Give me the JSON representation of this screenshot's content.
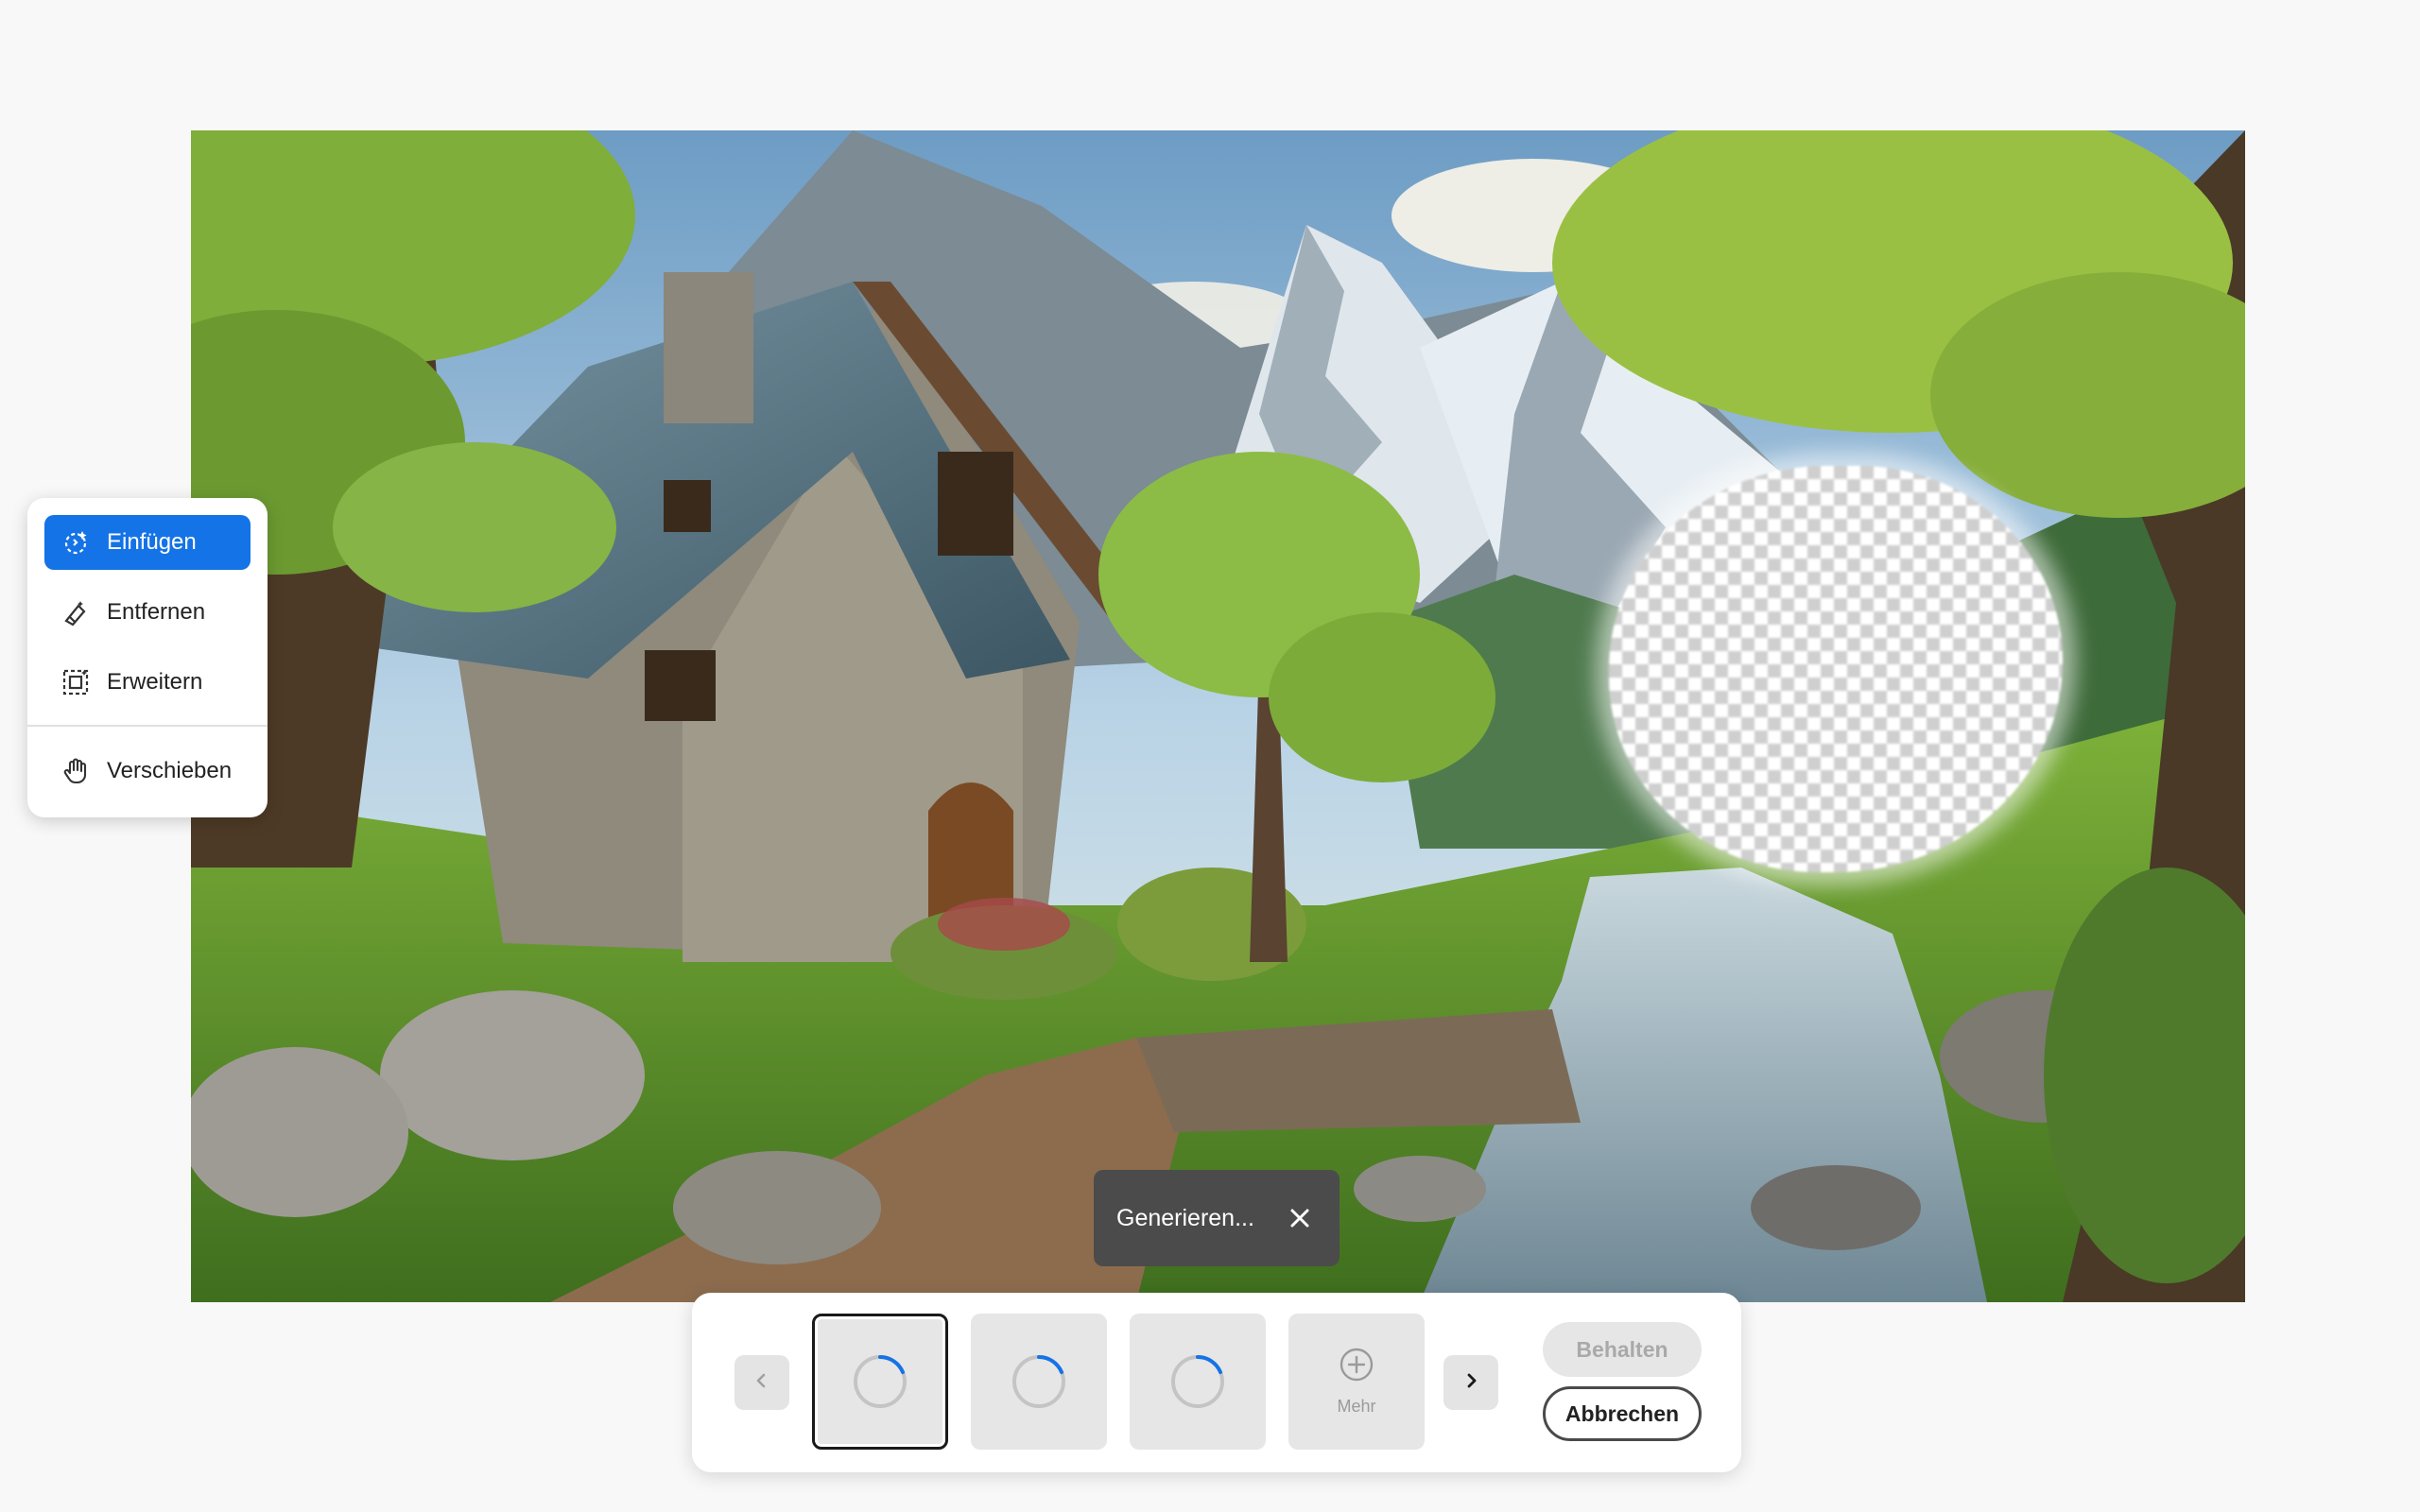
{
  "tool_menu": {
    "items": [
      {
        "label": "Einfügen",
        "icon": "generative-fill-icon",
        "active": true
      },
      {
        "label": "Entfernen",
        "icon": "eraser-icon",
        "active": false
      },
      {
        "label": "Erweitern",
        "icon": "expand-icon",
        "active": false
      },
      {
        "label": "Verschieben",
        "icon": "hand-icon",
        "active": false
      }
    ]
  },
  "toast": {
    "label": "Generieren...",
    "close_icon": "close-icon"
  },
  "variations": {
    "prev_icon": "chevron-left-icon",
    "next_icon": "chevron-right-icon",
    "thumbnails": [
      {
        "state": "loading",
        "selected": true
      },
      {
        "state": "loading",
        "selected": false
      },
      {
        "state": "loading",
        "selected": false
      }
    ],
    "more_label": "Mehr",
    "more_icon": "plus-circle-icon"
  },
  "actions": {
    "keep_label": "Behalten",
    "cancel_label": "Abbrechen"
  },
  "colors": {
    "accent": "#1473e6",
    "toast_bg": "#4b4b4b",
    "spinner": "#1473e6"
  }
}
